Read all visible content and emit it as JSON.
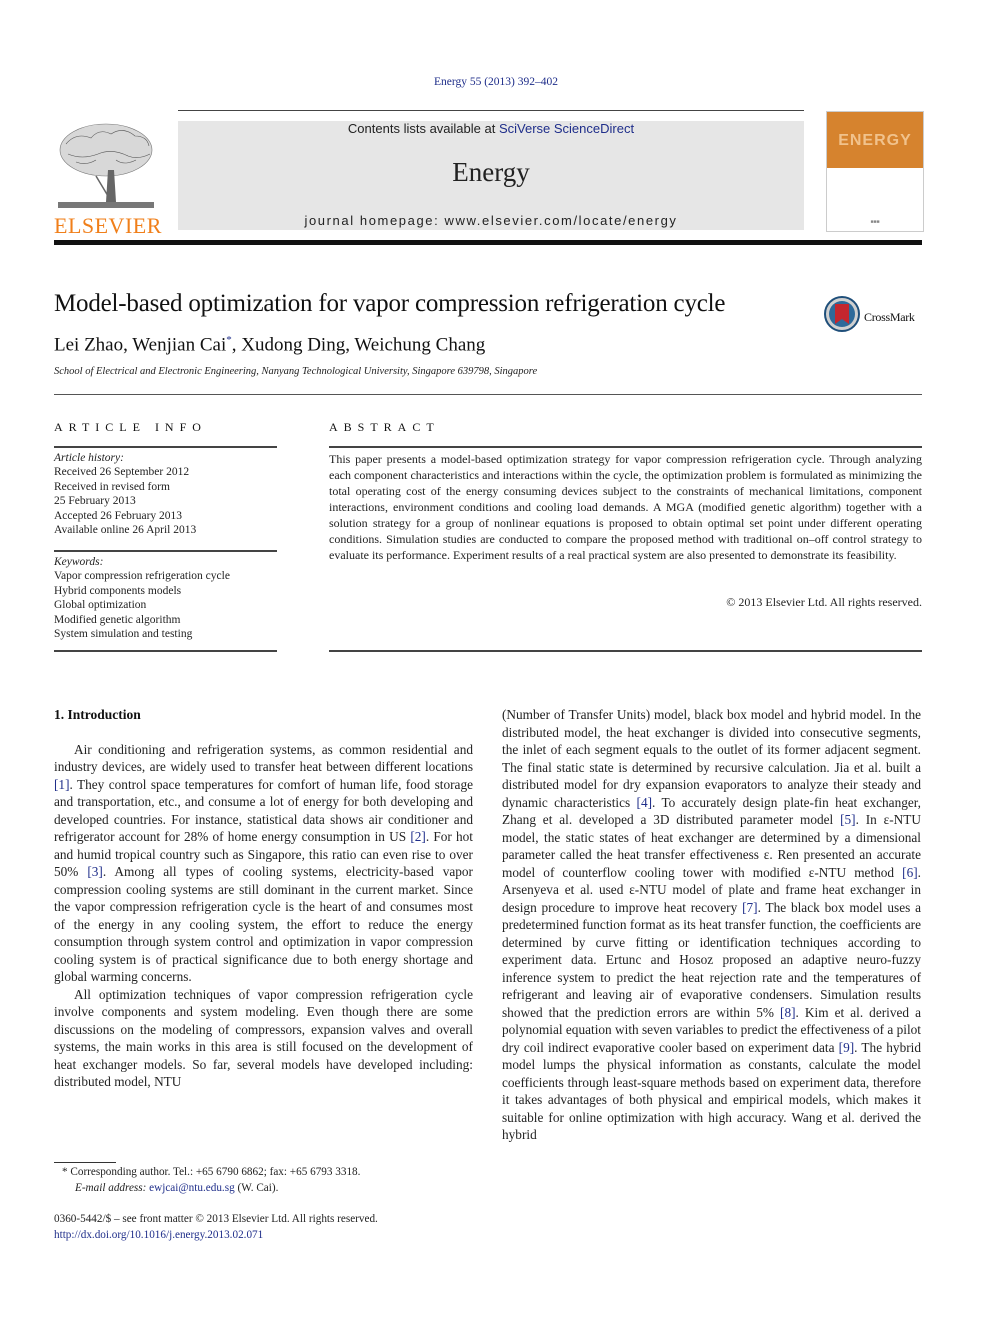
{
  "header": {
    "citation": "Energy 55 (2013) 392–402",
    "contents_prefix": "Contents lists available at ",
    "contents_link": "SciVerse ScienceDirect",
    "journal_name": "Energy",
    "homepage": "journal homepage: www.elsevier.com/locate/energy",
    "publisher_logo_text": "ELSEVIER",
    "cover_title": "ENERGY",
    "brand_color": "#f07f1a",
    "cover_color": "#d6832e"
  },
  "article": {
    "title": "Model-based optimization for vapor compression refrigeration cycle",
    "crossmark_label": "CrossMark",
    "authors_before": "Lei Zhao, Wenjian Cai",
    "authors_mark": "*",
    "authors_after": ", Xudong Ding, Weichung Chang",
    "affiliation": "School of Electrical and Electronic Engineering, Nanyang Technological University, Singapore 639798, Singapore"
  },
  "article_info": {
    "heading": "ARTICLE INFO",
    "history_label": "Article history:",
    "history": [
      "Received 26 September 2012",
      "Received in revised form",
      "25 February 2013",
      "Accepted 26 February 2013",
      "Available online 26 April 2013"
    ],
    "keywords_label": "Keywords:",
    "keywords": [
      "Vapor compression refrigeration cycle",
      "Hybrid components models",
      "Global optimization",
      "Modified genetic algorithm",
      "System simulation and testing"
    ]
  },
  "abstract": {
    "heading": "ABSTRACT",
    "text": "This paper presents a model-based optimization strategy for vapor compression refrigeration cycle. Through analyzing each component characteristics and interactions within the cycle, the optimization problem is formulated as minimizing the total operating cost of the energy consuming devices subject to the constraints of mechanical limitations, component interactions, environment conditions and cooling load demands. A MGA (modified genetic algorithm) together with a solution strategy for a group of nonlinear equations is proposed to obtain optimal set point under different operating conditions. Simulation studies are conducted to compare the proposed method with traditional on–off control strategy to evaluate its performance. Experiment results of a real practical system are also presented to demonstrate its feasibility.",
    "copyright": "© 2013 Elsevier Ltd. All rights reserved."
  },
  "introduction": {
    "heading": "1.  Introduction",
    "p1": [
      "Air conditioning and refrigeration systems, as common residential and industry devices, are widely used to transfer heat between different locations ",
      "[1]",
      ". They control space temperatures for comfort of human life, food storage and transportation, etc., and consume a lot of energy for both developing and developed countries. For instance, statistical data shows air conditioner and refrigerator account for 28% of home energy consumption in US ",
      "[2]",
      ". For hot and humid tropical country such as Singapore, this ratio can even rise to over 50% ",
      "[3]",
      ". Among all types of cooling systems, electricity-based vapor compression cooling systems are still dominant in the current market. Since the vapor compression refrigeration cycle is the heart of and consumes most of the energy in any cooling system, the effort to reduce the energy consumption through system control and optimization in vapor compression cooling system is of practical significance due to both energy shortage and global warming concerns."
    ],
    "p2": "All optimization techniques of vapor compression refrigeration cycle involve components and system modeling. Even though there are some discussions on the modeling of compressors, expansion valves and overall systems, the main works in this area is still focused on the development of heat exchanger models. So far, several models have developed including: distributed model, NTU",
    "p3": [
      "(Number of Transfer Units) model, black box model and hybrid model. In the distributed model, the heat exchanger is divided into consecutive segments, the inlet of each segment equals to the outlet of its former adjacent segment. The final static state is determined by recursive calculation. Jia et al. built a distributed model for dry expansion evaporators to analyze their steady and dynamic characteristics ",
      "[4]",
      ". To accurately design plate-fin heat exchanger, Zhang et al. developed a 3D distributed parameter model ",
      "[5]",
      ". In ε-NTU model, the static states of heat exchanger are determined by a dimensional parameter called the heat transfer effectiveness ε. Ren presented an accurate model of counterflow cooling tower with modified ε-NTU method ",
      "[6]",
      ". Arsenyeva et al. used ε-NTU model of plate and frame heat exchanger in design procedure to improve heat recovery ",
      "[7]",
      ". The black box model uses a predetermined function format as its heat transfer function, the coefficients are determined by curve fitting or identification techniques according to experiment data. Ertunc and Hosoz proposed an adaptive neuro-fuzzy inference system to predict the heat rejection rate and the temperatures of refrigerant and leaving air of evaporative condensers. Simulation results showed that the prediction errors are within 5% ",
      "[8]",
      ". Kim et al. derived a polynomial equation with seven variables to predict the effectiveness of a pilot dry coil indirect evaporative cooler based on experiment data ",
      "[9]",
      ". The hybrid model lumps the physical information as constants, calculate the model coefficients through least-square methods based on experiment data, therefore it takes advantages of both physical and empirical models, which makes it suitable for online optimization with high accuracy. Wang et al. derived the hybrid"
    ]
  },
  "footnote": {
    "mark": "*",
    "corresponding": " Corresponding author. Tel.: +65 6790 6862; fax: +65 6793 3318.",
    "email_label": "E-mail address: ",
    "email": "ewjcai@ntu.edu.sg",
    "email_suffix": " (W. Cai).",
    "front_matter": "0360-5442/$ – see front matter © 2013 Elsevier Ltd. All rights reserved.",
    "doi": "http://dx.doi.org/10.1016/j.energy.2013.02.071"
  }
}
